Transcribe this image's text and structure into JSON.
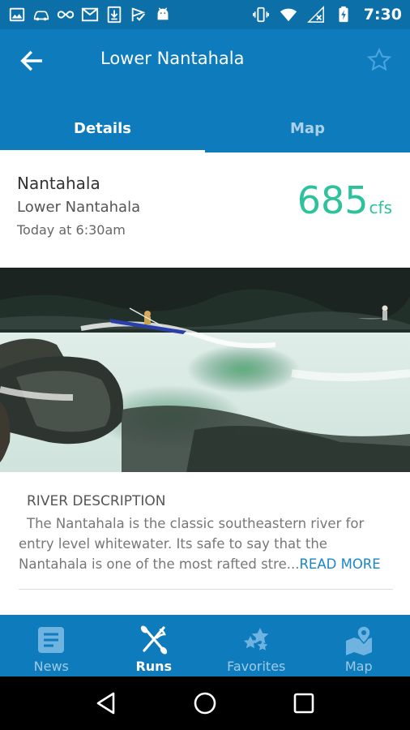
{
  "status_bar": {
    "time": "7:30",
    "left_icons": [
      "image-icon",
      "car-icon",
      "infinity-icon",
      "gmail-icon",
      "download-icon",
      "check-flag-icon",
      "android-icon"
    ],
    "right_icons": [
      "vibrate-icon",
      "wifi-icon",
      "no-signal-icon",
      "battery-charging-icon"
    ]
  },
  "app_bar": {
    "title": "Lower Nantahala",
    "back_icon": "arrow-back-icon",
    "favorite_icon": "star-outline-icon"
  },
  "tabs": [
    {
      "label": "Details",
      "active": true
    },
    {
      "label": "Map",
      "active": false
    }
  ],
  "run": {
    "river": "Nantahala",
    "name": "Lower Nantahala",
    "updated": "Today at 6:30am",
    "flow_value": "685",
    "flow_unit": "cfs"
  },
  "description": {
    "title": "RIVER DESCRIPTION",
    "text": "The Nantahala is the classic southeastern river for entry level whitewater. Its safe to say that the Nantahala is one of the most rafted stre...",
    "read_more": "READ MORE"
  },
  "bottom_nav": [
    {
      "label": "News",
      "icon": "news-icon",
      "active": false
    },
    {
      "label": "Runs",
      "icon": "kayak-paddle-icon",
      "active": true
    },
    {
      "label": "Favorites",
      "icon": "stars-icon",
      "active": false
    },
    {
      "label": "Map",
      "icon": "map-pin-icon",
      "active": false
    }
  ],
  "colors": {
    "primary": "#0e7bbd",
    "status_bar": "#0d6fa8",
    "flow": "#2cc29b",
    "link": "#1a86c8"
  }
}
